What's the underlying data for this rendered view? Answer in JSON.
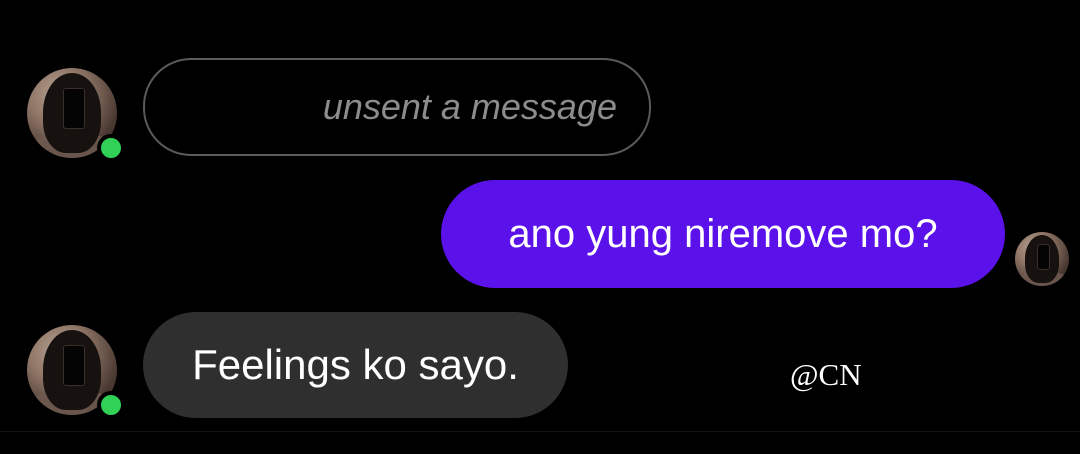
{
  "conversation": {
    "messages": [
      {
        "sender": "other",
        "type": "unsent",
        "text": "unsent a message"
      },
      {
        "sender": "me",
        "type": "sent",
        "text": "ano yung niremove mo?"
      },
      {
        "sender": "other",
        "type": "received",
        "text": "Feelings ko sayo."
      }
    ]
  },
  "watermark": "@CN",
  "colors": {
    "background": "#000000",
    "sent_bubble": "#5b12ea",
    "received_bubble": "#2f2f2f",
    "unsent_border": "#5a5a5a",
    "online_indicator": "#31d158"
  }
}
